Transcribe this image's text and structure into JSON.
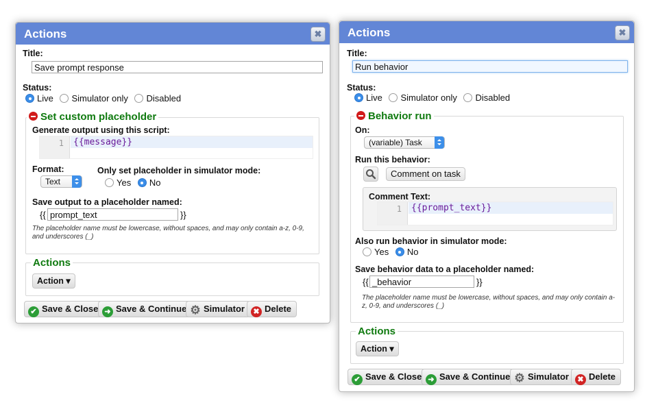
{
  "dialog_left": {
    "title": "Actions",
    "close_glyph": "✖",
    "title_label": "Title:",
    "title_value": "Save prompt response",
    "status_label": "Status:",
    "status_options": [
      "Live",
      "Simulator only",
      "Disabled"
    ],
    "status_selected": "Live",
    "section_title": "Set custom placeholder",
    "script_label": "Generate output using this script:",
    "code_line_number": "1",
    "code_text": "{{message}}",
    "format_label": "Format:",
    "format_value": "Text",
    "sim_only_label": "Only set placeholder in simulator mode:",
    "sim_only_options": [
      "Yes",
      "No"
    ],
    "sim_only_selected": "No",
    "placeholder_label": "Save output to a placeholder named:",
    "brace_open": "{{",
    "brace_close": "}}",
    "placeholder_value": "prompt_text",
    "placeholder_help": "The placeholder name must be lowercase, without spaces, and may only contain a-z, 0-9, and underscores (_)",
    "actions_legend": "Actions",
    "action_button": "Action ▾",
    "buttons": {
      "save_close": "Save & Close",
      "save_continue": "Save & Continue",
      "simulator": "Simulator",
      "delete": "Delete"
    }
  },
  "dialog_right": {
    "title": "Actions",
    "close_glyph": "✖",
    "title_label": "Title:",
    "title_value": "Run behavior",
    "status_label": "Status:",
    "status_options": [
      "Live",
      "Simulator only",
      "Disabled"
    ],
    "status_selected": "Live",
    "section_title": "Behavior run",
    "on_label": "On:",
    "on_value": "(variable) Task",
    "run_label": "Run this behavior:",
    "behavior_button": "Comment on task",
    "comment_label": "Comment Text:",
    "code_line_number": "1",
    "code_text": "{{prompt_text}}",
    "sim_label": "Also run behavior in simulator mode:",
    "sim_options": [
      "Yes",
      "No"
    ],
    "sim_selected": "No",
    "placeholder_label": "Save behavior data to a placeholder named:",
    "brace_open": "{{",
    "brace_close": "}}",
    "placeholder_value": "_behavior",
    "placeholder_help": "The placeholder name must be lowercase, without spaces, and may only contain a-z, 0-9, and underscores (_)",
    "actions_legend": "Actions",
    "action_button": "Action ▾",
    "buttons": {
      "save_close": "Save & Close",
      "save_continue": "Save & Continue",
      "simulator": "Simulator",
      "delete": "Delete"
    }
  },
  "icons": {
    "check": "✔",
    "arrow": "➜",
    "gear": "⚙",
    "x": "✖"
  },
  "colors": {
    "titlebar": "#6286d6",
    "section_green": "#0f7a0f",
    "radio_on": "#3b8ee8",
    "button_green": "#2c9d37",
    "button_red": "#d12424"
  }
}
